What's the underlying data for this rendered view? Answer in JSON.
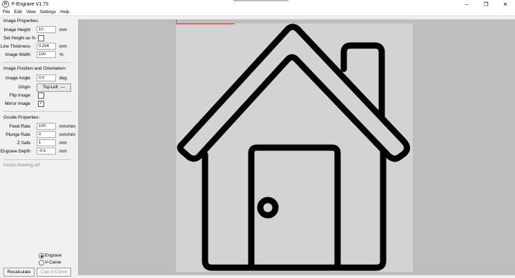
{
  "window": {
    "title": "F-Engrave V1.73",
    "icon_glyph": "⚙"
  },
  "menu": [
    "File",
    "Edit",
    "View",
    "Settings",
    "Help"
  ],
  "image_properties": {
    "title": "Image Properties:",
    "image_height": {
      "label": "Image Height",
      "value": "10",
      "unit": "mm"
    },
    "set_height_pct": {
      "label": "Set Height as %",
      "checked": false
    },
    "line_thickness": {
      "label": "Line Thickness",
      "value": "0.254",
      "unit": "mm"
    },
    "image_width": {
      "label": "Image Width",
      "value": "100",
      "unit": "%"
    }
  },
  "position": {
    "title": "Image Position and Orientation:",
    "image_angle": {
      "label": "Image Angle",
      "value": "0.0",
      "unit": "deg"
    },
    "origin": {
      "label": "Origin",
      "value": "Top-Left"
    },
    "flip_image": {
      "label": "Flip Image",
      "checked": false
    },
    "mirror_image": {
      "label": "Mirror Image",
      "checked": true
    }
  },
  "gcode": {
    "title": "Gcode Properties:",
    "feed_rate": {
      "label": "Feed Rate",
      "value": "100",
      "unit": "mm/min"
    },
    "plunge_rate": {
      "label": "Plunge Rate",
      "value": "0",
      "unit": "mm/min"
    },
    "z_safe": {
      "label": "Z Safe",
      "value": "1",
      "unit": "mm"
    },
    "engrave_depth": {
      "label": "Engrave Depth",
      "value": "-0.5",
      "unit": "mm"
    }
  },
  "file_name": "house-drawing.dxf",
  "mode": {
    "engrave": "Engrave",
    "vcarve": "V-Carve",
    "selected": "engrave"
  },
  "buttons": {
    "recalculate": "Recalculate",
    "calc_vcarve": "Calc V-Carve"
  },
  "colors": {
    "work_area": "#d3d3d3",
    "canvas_bg": "#bebebe",
    "x_axis": "#e03030",
    "y_axis": "#30b030",
    "drawing": "#000000"
  }
}
